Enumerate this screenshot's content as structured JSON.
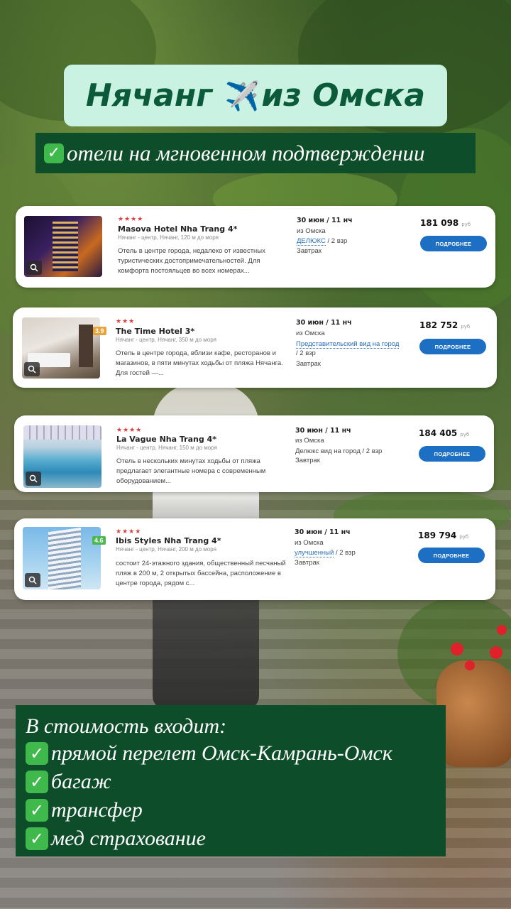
{
  "header": {
    "title_part1": "Нячанг",
    "plane_icon": "✈️",
    "title_part2": "из Омска",
    "subtitle_check": "✓",
    "subtitle": "отели на мгновенном подтверждении"
  },
  "colors": {
    "title_bg": "#c9f2e3",
    "title_text": "#0b5a3a",
    "dark_green": "#0e4d2a",
    "check_green": "#3fb94b",
    "button_blue": "#1d6fc4",
    "star_red": "#e03a3a"
  },
  "hotels": [
    {
      "stars": "★★★★",
      "name": "Masova Hotel Nha Trang 4*",
      "location": "Нячанг - центр, Нячанг, 120 м до моря",
      "description": "Отель в центре города, недалеко от известных туристических достопримечательностей. Для комфорта постояльцев во всех номерах...",
      "rating": "",
      "date": "30 июн / 11 нч",
      "from": "из Омска",
      "room_link": "ДЕЛЮКС",
      "room_rest": " / 2 взр",
      "meal": "Завтрак",
      "price": "181 098",
      "currency": "руб",
      "button": "ПОДРОБНЕЕ"
    },
    {
      "stars": "★★★",
      "name": "The Time Hotel 3*",
      "location": "Нячанг - центр, Нячанг, 350 м до моря",
      "description": "Отель в центре города, вблизи кафе, ресторанов и магазинов, в пяти минутах ходьбы от пляжа Нячанга. Для гостей —...",
      "rating": "3.9",
      "date": "30 июн / 11 нч",
      "from": "из Омска",
      "room_link": "Представительский вид на город",
      "room_rest": " / 2 взр",
      "meal": "Завтрак",
      "price": "182 752",
      "currency": "руб",
      "button": "ПОДРОБНЕЕ"
    },
    {
      "stars": "★★★★",
      "name": "La Vague Nha Trang 4*",
      "location": "Нячанг - центр, Нячанг, 150 м до моря",
      "description": "Отель в нескольких минутах ходьбы от пляжа предлагает элегантные номера с современным оборудованием...",
      "rating": "",
      "date": "30 июн / 11 нч",
      "from": "из Омска",
      "room_link": "",
      "room_rest": "Делюкс вид на город / 2 взр",
      "meal": "Завтрак",
      "price": "184 405",
      "currency": "руб",
      "button": "ПОДРОБНЕЕ"
    },
    {
      "stars": "★★★★",
      "name": "Ibis Styles Nha Trang 4*",
      "location": "Нячанг - центр, Нячанг, 200 м до моря",
      "description": "состоит 24-этажного здания, общественный песчаный пляж в 200 м, 2 открытых бассейна, расположение в центре города, рядом с...",
      "rating": "4.6",
      "date": "30 июн / 11 нч",
      "from": "из Омска",
      "room_link": "улучшенный",
      "room_rest": " / 2 взр",
      "meal": "Завтрак",
      "price": "189 794",
      "currency": "руб",
      "button": "ПОДРОБНЕЕ"
    }
  ],
  "included": {
    "title": "В стоимость входит:",
    "items": [
      "прямой перелет Омск-Камрань-Омск",
      "багаж",
      "трансфер",
      "мед страхование"
    ]
  }
}
